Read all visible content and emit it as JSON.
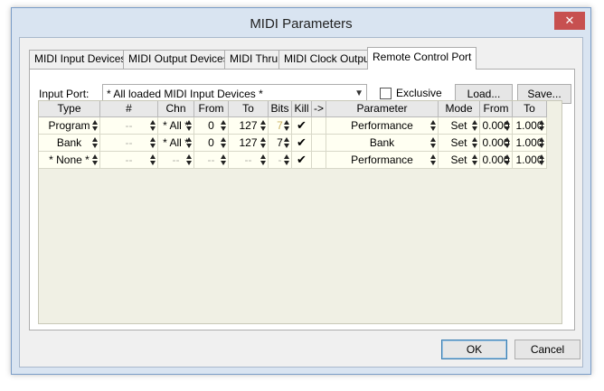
{
  "window": {
    "title": "MIDI Parameters",
    "close_glyph": "✕"
  },
  "tabs": [
    {
      "label": "MIDI Input Devices"
    },
    {
      "label": "MIDI Output Devices"
    },
    {
      "label": "MIDI Thru"
    },
    {
      "label": "MIDI Clock Output"
    },
    {
      "label": "Remote Control Port",
      "active": true
    }
  ],
  "input_port": {
    "label": "Input Port:",
    "value": "* All loaded MIDI Input Devices *"
  },
  "exclusive": {
    "label": "Exclusive",
    "checked": false
  },
  "buttons": {
    "load": "Load...",
    "save": "Save...",
    "ok": "OK",
    "cancel": "Cancel"
  },
  "table": {
    "headers": [
      "Type",
      "#",
      "Chn",
      "From",
      "To",
      "Bits",
      "Kill",
      "->",
      "Parameter",
      "Mode",
      "From",
      "To"
    ],
    "rows": [
      {
        "type": "Program",
        "num": "--",
        "chn": "* All *",
        "from": "0",
        "to": "127",
        "bits": "7",
        "kill": "✔",
        "param": "Performance",
        "mode": "Set",
        "pfrom": "0.000",
        "pto": "1.000"
      },
      {
        "type": "Bank",
        "num": "--",
        "chn": "* All *",
        "from": "0",
        "to": "127",
        "bits": "7",
        "kill": "✔",
        "param": "Bank",
        "mode": "Set",
        "pfrom": "0.000",
        "pto": "1.000"
      },
      {
        "type": "* None *",
        "num": "--",
        "chn": "--",
        "from": "--",
        "to": "--",
        "bits": "-",
        "kill": "✔",
        "param": "Performance",
        "mode": "Set",
        "pfrom": "0.000",
        "pto": "1.000"
      }
    ]
  }
}
